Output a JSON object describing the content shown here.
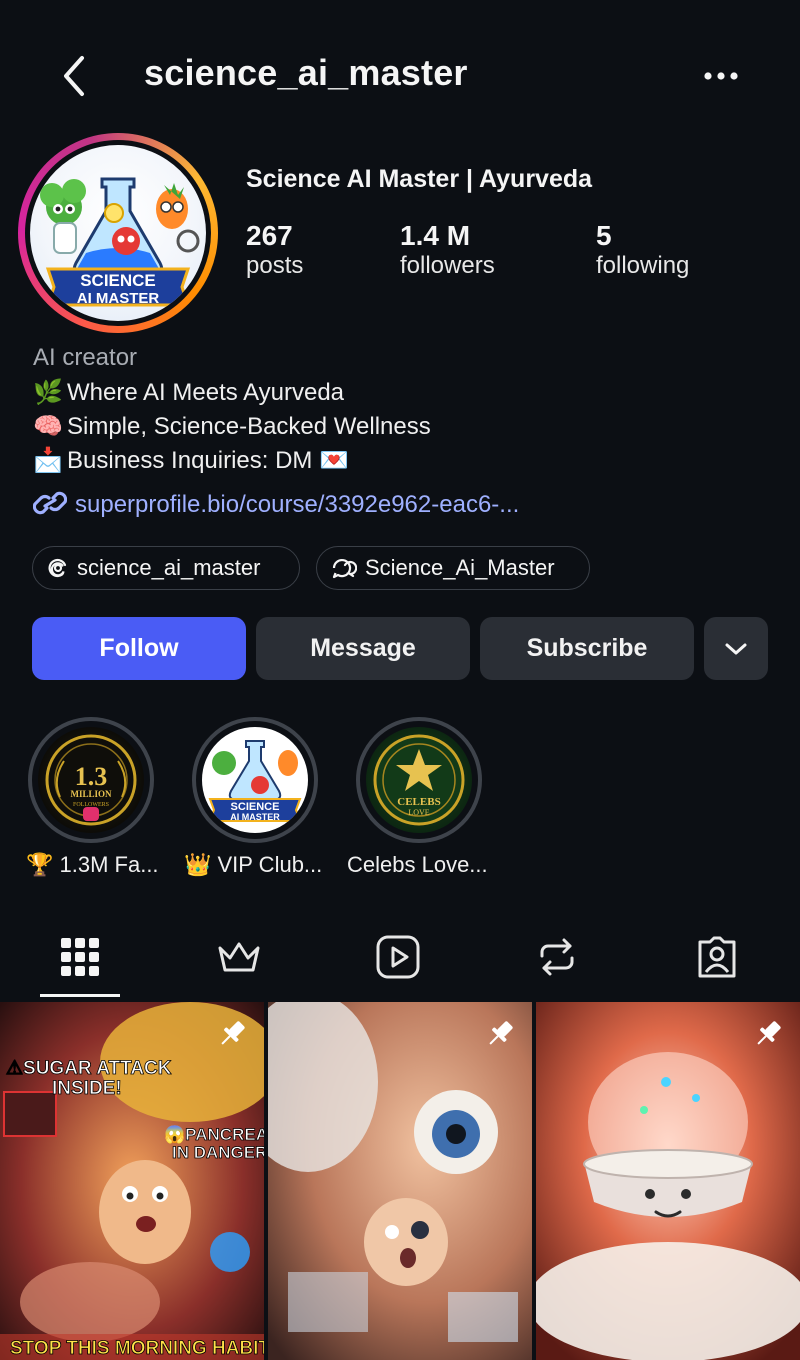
{
  "header": {
    "username": "science_ai_master",
    "back_icon": "chevron-left-icon",
    "more_icon": "more-horizontal-icon"
  },
  "profile": {
    "display_name": "Science AI Master | Ayurveda",
    "avatar_text_line1": "SCIENCE",
    "avatar_text_line2": "AI MASTER",
    "stats": {
      "posts_count": "267",
      "posts_label": "posts",
      "followers_count": "1.4 M",
      "followers_label": "followers",
      "following_count": "5",
      "following_label": "following"
    }
  },
  "bio": {
    "category": "AI creator",
    "lines": [
      {
        "emoji": "🌿",
        "text": "Where AI Meets Ayurveda"
      },
      {
        "emoji": "🧠",
        "text": "Simple, Science-Backed Wellness"
      },
      {
        "emoji": "📩",
        "text": "Business Inquiries: DM 💌"
      }
    ],
    "link_text": "superprofile.bio/course/3392e962-eac6-..."
  },
  "chips": [
    {
      "icon": "threads-icon",
      "label": "science_ai_master"
    },
    {
      "icon": "chat-bubbles-icon",
      "label": "Science_Ai_Master"
    }
  ],
  "actions": {
    "follow": "Follow",
    "message": "Message",
    "subscribe": "Subscribe",
    "dropdown_icon": "chevron-down-icon"
  },
  "highlights": [
    {
      "label": "🏆 1.3M Fa...",
      "badge_top": "1.3",
      "badge_sub": "MILLION",
      "badge_small": "FOLLOWERS"
    },
    {
      "label": "👑 VIP Club...",
      "badge_top": "SCIENCE",
      "badge_sub": "AI MASTER"
    },
    {
      "label": "Celebs Love...",
      "badge_top": "CELEBS",
      "badge_sub": "LOVE"
    }
  ],
  "tabs": [
    {
      "name": "grid",
      "icon": "grid-icon",
      "active": true
    },
    {
      "name": "subscriptions",
      "icon": "crown-icon"
    },
    {
      "name": "reels",
      "icon": "reels-play-icon"
    },
    {
      "name": "reposts",
      "icon": "repost-icon"
    },
    {
      "name": "tagged",
      "icon": "tagged-person-icon"
    }
  ],
  "posts": [
    {
      "pinned": true,
      "caption_top_1": "⚠SUGAR ATTACK",
      "caption_top_2": "INSIDE!",
      "caption_mid_1": "😱PANCREAS",
      "caption_mid_2": "IN DANGER!",
      "caption_bottom": "STOP THIS MORNING HABIT!"
    },
    {
      "pinned": true
    },
    {
      "pinned": true
    }
  ],
  "colors": {
    "background": "#0c0f14",
    "follow_button": "#4a5cf5",
    "secondary_button": "#2a2e35",
    "link": "#9fb0ff"
  }
}
